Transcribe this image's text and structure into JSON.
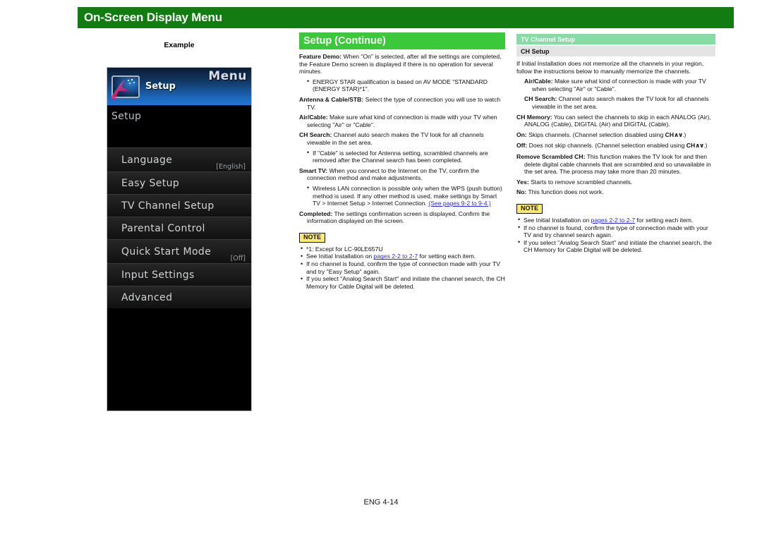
{
  "header": {
    "title": "On-Screen Display Menu"
  },
  "example": {
    "label": "Example",
    "tv_menu": {
      "menu_word": "Menu",
      "icon_name": "tv-setup-icon",
      "top_title": "Setup",
      "heading": "Setup",
      "rows": [
        {
          "label": "Language",
          "value": "[English]"
        },
        {
          "label": "Easy Setup",
          "value": ""
        },
        {
          "label": "TV Channel Setup",
          "value": ""
        },
        {
          "label": "Parental Control",
          "value": ""
        },
        {
          "label": "Quick Start Mode",
          "value": "[Off]"
        },
        {
          "label": "Input Settings",
          "value": ""
        },
        {
          "label": "Advanced",
          "value": ""
        }
      ]
    }
  },
  "middle": {
    "title": "Setup (Continue)",
    "feature_demo_term": "Feature Demo:",
    "feature_demo_text": " When \"On\" is selected, after all the settings are completed, the Feature Demo screen is displayed if there is no operation for several minutes.",
    "feature_demo_bullets": [
      "ENERGY STAR qualification is based on AV MODE \"STANDARD (ENERGY STAR)*1\"."
    ],
    "antenna_term": "Antenna & Cable/STB:",
    "antenna_text": " Select the type of connection you will use to watch TV.",
    "aircable_term": "Air/Cable:",
    "aircable_text": " Make sure what kind of connection is made with your TV when selecting \"Air\" or \"Cable\".",
    "chsearch_term": "CH Search:",
    "chsearch_text": " Channel auto search makes the TV look for all channels viewable in the set area.",
    "chsearch_bullets": [
      "If \"Cable\" is selected for Antenna setting, scrambled channels are removed after the Channel search has been completed."
    ],
    "smarttv_term": "Smart TV:",
    "smarttv_text": " When you connect to the Internet on the TV, confirm the connection method and make adjustments.",
    "smarttv_bullet_text": "Wireless LAN connection is possible only when the WPS (push button) method is used. If any other method is used, make settings by Smart TV > Internet Setup > Internet Connection. ",
    "smarttv_bullet_link": "(See pages 9-2 to 9-4.)",
    "completed_term": "Completed:",
    "completed_text": " The settings confirmation screen is displayed. Confirm the information displayed on the screen.",
    "note_label": "NOTE",
    "note_1": "*1: Except for LC-90LE657U",
    "note_2_pre": "See Initial Installation on ",
    "note_2_link": "pages 2-2 to 2-7",
    "note_2_post": " for setting each item.",
    "note_3": "If no channel is found, confirm the type of connection made with your TV and try \"Easy Setup\" again.",
    "note_4": "If you select \"Analog Search Start\" and initiate the channel search, the CH Memory for Cable Digital will be deleted."
  },
  "right": {
    "title": "TV Channel Setup",
    "subtitle": "CH Setup",
    "intro": "If Initial Installation does not memorize all the channels in your region, follow the instructions below to manually memorize the channels.",
    "aircable_term": "Air/Cable:",
    "aircable_text": " Make sure what kind of connection is made with your TV when selecting \"Air\" or \"Cable\".",
    "chsearch_term": "CH Search:",
    "chsearch_text": " Channel auto search makes the TV look for all channels viewable in the set area.",
    "chmemory_term": "CH Memory:",
    "chmemory_text": " You can select the channels to skip in each ANALOG (Air), ANALOG (Cable), DIGITAL (Air) and DIGITAL (Cable).",
    "on_term": "On:",
    "on_text_pre": " Skips channels. (Channel selection disabled using ",
    "on_text_bold": "CH",
    "on_chev": "∧∨",
    "on_text_post": ".)",
    "off_term": "Off:",
    "off_text_pre": " Does not skip channels. (Channel selection enabled using ",
    "off_text_bold": "CH",
    "off_chev": "∧∨",
    "off_text_post": ".)",
    "remove_term": "Remove Scrambled CH:",
    "remove_text": " This function makes the TV look for and then delete digital cable channels that are scrambled and so unavailable in the set area. The process may take more than 20 minutes.",
    "yes_term": "Yes:",
    "yes_text": " Starts to remove scrambled channels.",
    "no_term": "No:",
    "no_text": " This function does not work.",
    "note_label": "NOTE",
    "note_1_pre": "See Initial Installation on ",
    "note_1_link": "pages 2-2 to 2-7",
    "note_1_post": " for setting each item.",
    "note_2": "If no channel is found, confirm the type of connection made with your TV and try channel search again.",
    "note_3": "If you select \"Analog Search Start\" and initiate the channel search, the CH Memory for Cable Digital will be deleted."
  },
  "footer": {
    "page": "ENG 4-14"
  }
}
